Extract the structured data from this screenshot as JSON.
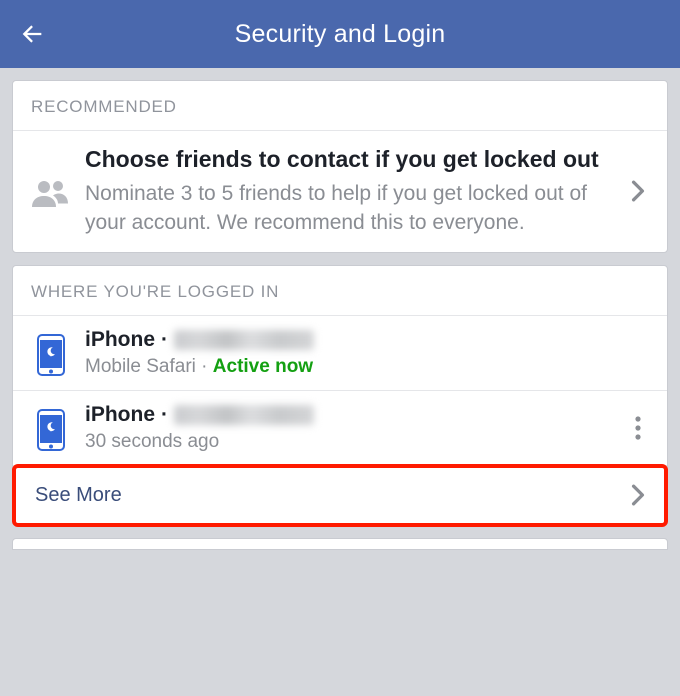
{
  "header": {
    "title": "Security and Login"
  },
  "recommended": {
    "header": "RECOMMENDED",
    "item": {
      "title": "Choose friends to contact if you get locked out",
      "subtitle": "Nominate 3 to 5 friends to help if you get locked out of your account. We recommend this to everyone."
    }
  },
  "sessions": {
    "header": "WHERE YOU'RE LOGGED IN",
    "items": [
      {
        "device": "iPhone",
        "browser": "Mobile Safari",
        "status": "Active now",
        "is_active": true
      },
      {
        "device": "iPhone",
        "time": "30 seconds ago",
        "is_active": false
      }
    ],
    "see_more": "See More"
  },
  "glyphs": {
    "dot": "·"
  }
}
